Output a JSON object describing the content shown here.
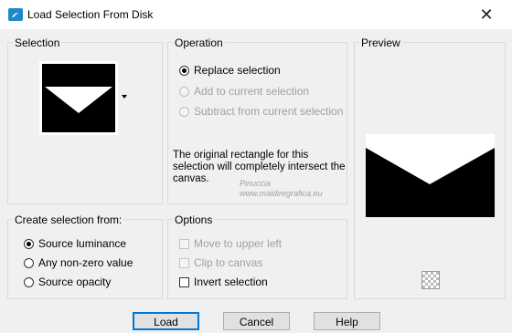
{
  "window": {
    "title": "Load Selection From Disk",
    "close_glyph": "✕",
    "accent_color": "#0078d7"
  },
  "selection_group": {
    "label": "Selection"
  },
  "operation_group": {
    "label": "Operation",
    "options": [
      {
        "label": "Replace selection",
        "checked": true,
        "enabled": true
      },
      {
        "label": "Add to current selection",
        "checked": false,
        "enabled": false
      },
      {
        "label": "Subtract from current selection",
        "checked": false,
        "enabled": false
      }
    ],
    "info_text": "The original rectangle for this selection will completely intersect the canvas."
  },
  "preview_group": {
    "label": "Preview"
  },
  "create_from_group": {
    "label": "Create selection from:",
    "options": [
      {
        "label": "Source luminance",
        "checked": true
      },
      {
        "label": "Any non-zero value",
        "checked": false
      },
      {
        "label": "Source opacity",
        "checked": false
      }
    ]
  },
  "options_group": {
    "label": "Options",
    "items": [
      {
        "label": "Move to upper left",
        "checked": false,
        "enabled": false
      },
      {
        "label": "Clip to canvas",
        "checked": false,
        "enabled": false
      },
      {
        "label": "Invert selection",
        "checked": false,
        "enabled": true
      }
    ]
  },
  "buttons": {
    "load": "Load",
    "cancel": "Cancel",
    "help": "Help"
  },
  "watermark": {
    "line1": "Pinuccia",
    "line2": "www.maidiregrafica.eu"
  }
}
